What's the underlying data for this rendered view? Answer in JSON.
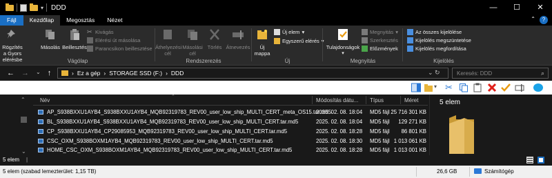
{
  "window": {
    "title": "DDD",
    "controls": {
      "minimize": "—",
      "maximize": "☐",
      "close": "✕"
    }
  },
  "ribbon_tabs": {
    "file": "Fájl",
    "home": "Kezdőlap",
    "share": "Megosztás",
    "view": "Nézet"
  },
  "ribbon": {
    "clipboard": {
      "pin": "Rögzítés a Gyors elérésbe",
      "copy": "Másolás",
      "paste": "Beillesztés",
      "cut": "Kivágás",
      "copy_path": "Elérési út másolása",
      "paste_shortcut": "Parancsikon beillesztése",
      "label": "Vágólap"
    },
    "organize": {
      "move_to": "Áthelyezési cél",
      "copy_to": "Másolási cél",
      "delete": "Törlés",
      "rename": "Átnevezés",
      "label": "Rendszerezés"
    },
    "new": {
      "new_folder": "Új mappa",
      "new_item": "Új elem",
      "easy_access": "Egyszerű elérés",
      "label": "Új"
    },
    "open": {
      "properties": "Tulajdonságok",
      "open": "Megnyitás",
      "edit": "Szerkesztés",
      "history": "Előzmények",
      "label": "Megnyitás"
    },
    "select": {
      "select_all": "Az összes kijelölése",
      "select_none": "Kijelölés megszüntetése",
      "invert": "Kijelölés megfordítása",
      "label": "Kijelölés"
    }
  },
  "address": {
    "segments": [
      "Ez a gép",
      "STORAGE SSD (F:)",
      "DDD"
    ],
    "search_placeholder": "Keresés: DDD"
  },
  "columns": {
    "name": "Név",
    "modified": "Módosítás dátu...",
    "type": "Típus",
    "size": "Méret"
  },
  "files": [
    {
      "name": "AP_S938BXXU1AYB4_S938BXXU1AYB4_MQB92319783_REV00_user_low_ship_MULTI_CERT_meta_OS15.tar.md5",
      "modified": "2025. 02. 08. 18:04",
      "type": "MD5 fájl",
      "size": "25 716 301 KB"
    },
    {
      "name": "BL_S938BXXU1AYB4_S938BXXU1AYB4_MQB92319783_REV00_user_low_ship_MULTI_CERT.tar.md5",
      "modified": "2025. 02. 08. 18:04",
      "type": "MD5 fájl",
      "size": "129 271 KB"
    },
    {
      "name": "CP_S938BXXU1AYB4_CP29085953_MQB92319783_REV00_user_low_ship_MULTI_CERT.tar.md5",
      "modified": "2025. 02. 08. 18:28",
      "type": "MD5 fájl",
      "size": "86 801 KB"
    },
    {
      "name": "CSC_OXM_S938BOXM1AYB4_MQB92319783_REV00_user_low_ship_MULTI_CERT.tar.md5",
      "modified": "2025. 02. 08. 18:30",
      "type": "MD5 fájl",
      "size": "1 013 061 KB"
    },
    {
      "name": "HOME_CSC_OXM_S938BOXM1AYB4_MQB92319783_REV00_user_low_ship_MULTI_CERT.tar.md5",
      "modified": "2025. 02. 08. 18:28",
      "type": "MD5 fájl",
      "size": "1 013 001 KB"
    }
  ],
  "preview": {
    "count": "5 elem"
  },
  "item_count": "5 elem",
  "status": {
    "left": "5 elem (szabad lemezterület: 1,15 TB)",
    "size": "26,6 GB",
    "computer": "Számítógép"
  },
  "colors": {
    "file_tab": "#1a6fc4",
    "folder": "#e8b43a",
    "delete_x": "#e0201a",
    "check": "#e89a10"
  }
}
